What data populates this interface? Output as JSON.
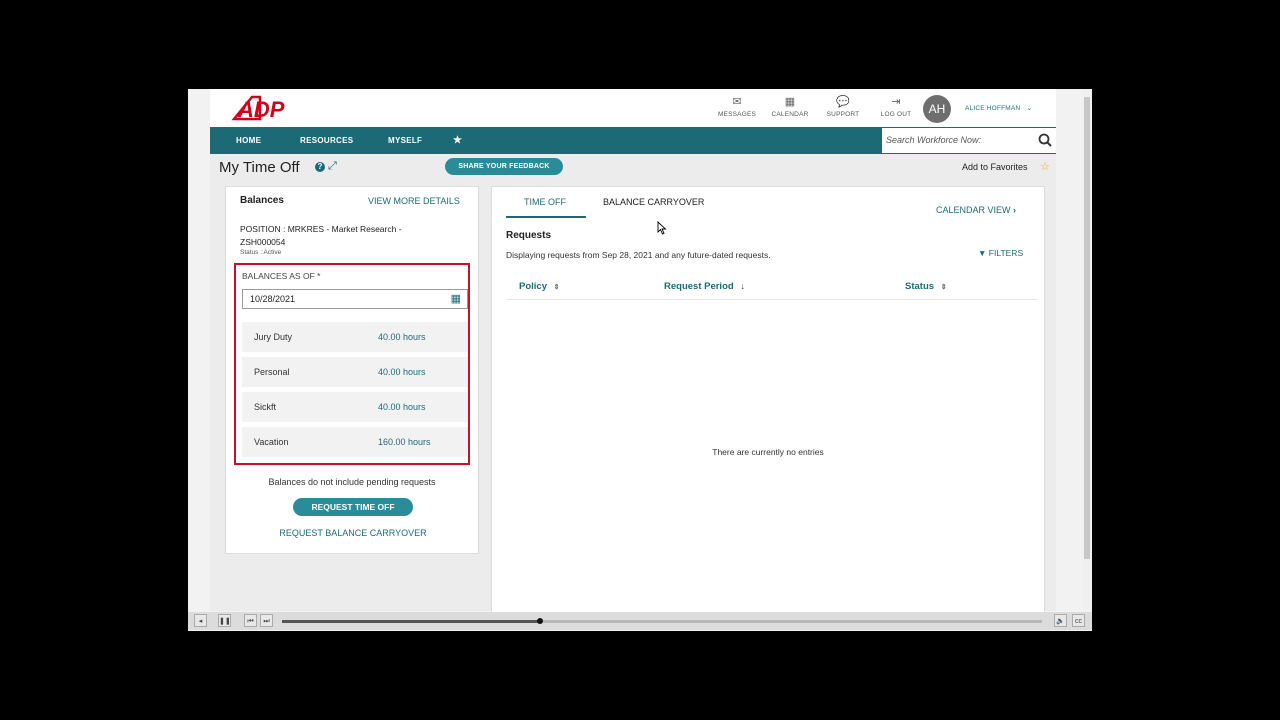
{
  "header": {
    "logo_text": "ADP",
    "icons": [
      {
        "label": "MESSAGES",
        "icon": "envelope-icon"
      },
      {
        "label": "CALENDAR",
        "icon": "calendar-icon"
      },
      {
        "label": "SUPPORT",
        "icon": "speech-bubble-icon"
      },
      {
        "label": "LOG OUT",
        "icon": "logout-icon"
      }
    ],
    "avatar_initials": "AH",
    "user_name": "ALICE HOFFMAN"
  },
  "nav": {
    "items": [
      "HOME",
      "RESOURCES",
      "MYSELF"
    ],
    "search_placeholder": "Search Workforce Now:"
  },
  "page": {
    "title": "My Time Off",
    "feedback_button": "SHARE YOUR FEEDBACK",
    "add_favorites": "Add to Favorites"
  },
  "balances": {
    "heading": "Balances",
    "view_more": "VIEW MORE DETAILS",
    "position_line1": "POSITION : MRKRES - Market Research -",
    "position_line2": "ZSH000054",
    "status": "Status : Active",
    "as_of_label": "BALANCES AS OF *",
    "as_of_date": "10/28/2021",
    "rows": [
      {
        "name": "Jury Duty",
        "value": "40.00 hours"
      },
      {
        "name": "Personal",
        "value": "40.00 hours"
      },
      {
        "name": "Sickft",
        "value": "40.00 hours"
      },
      {
        "name": "Vacation",
        "value": "160.00 hours"
      }
    ],
    "note": "Balances do not include pending requests",
    "request_button": "REQUEST TIME OFF",
    "carryover_link": "REQUEST BALANCE CARRYOVER"
  },
  "requests": {
    "tabs": [
      "TIME OFF",
      "BALANCE CARRYOVER"
    ],
    "active_tab": "TIME OFF",
    "calendar_view": "CALENDAR VIEW",
    "heading": "Requests",
    "description": "Displaying requests from Sep 28, 2021 and any future-dated requests.",
    "filters": "FILTERS",
    "columns": [
      "Policy",
      "Request Period",
      "Status"
    ],
    "empty_text": "There are currently no entries"
  },
  "player": {
    "progress": 0.34
  },
  "colors": {
    "brand_red": "#d0021b",
    "teal": "#1d6a77",
    "button_teal": "#2a8c99",
    "highlight_red": "#c8102e"
  }
}
